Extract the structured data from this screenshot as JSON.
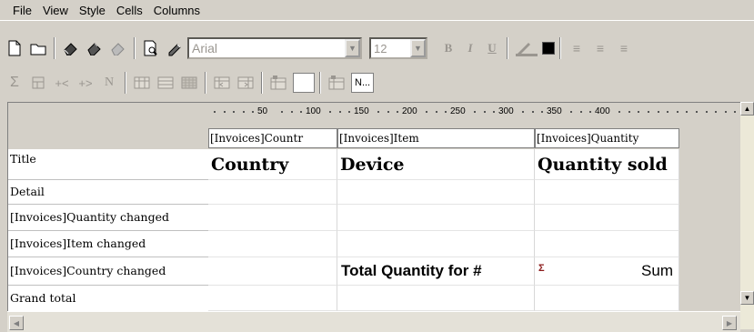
{
  "menu": [
    "File",
    "View",
    "Style",
    "Cells",
    "Columns"
  ],
  "toolbar": {
    "font_name": "Arial",
    "font_size": "12",
    "bold": "B",
    "italic": "I",
    "underline": "U",
    "n_button": "N..."
  },
  "ruler": {
    "labels": [
      "50",
      "100",
      "150",
      "200",
      "250",
      "300",
      "350",
      "400"
    ]
  },
  "columns": [
    {
      "header": "[Invoices]Countr"
    },
    {
      "header": "[Invoices]Item"
    },
    {
      "header": "[Invoices]Quantity"
    }
  ],
  "rows": [
    {
      "label": "Title",
      "cells": [
        "Country",
        "Device",
        "Quantity sold"
      ]
    },
    {
      "label": "Detail",
      "cells": [
        "",
        "",
        ""
      ]
    },
    {
      "label": "[Invoices]Quantity changed",
      "cells": [
        "",
        "",
        ""
      ]
    },
    {
      "label": "[Invoices]Item changed",
      "cells": [
        "",
        "",
        ""
      ]
    },
    {
      "label": "[Invoices]Country changed",
      "cells": [
        "",
        "Total Quantity for #",
        "Sum"
      ]
    },
    {
      "label": "Grand total",
      "cells": [
        "",
        "",
        ""
      ]
    }
  ],
  "icons": {
    "sigma": "sum-icon"
  }
}
